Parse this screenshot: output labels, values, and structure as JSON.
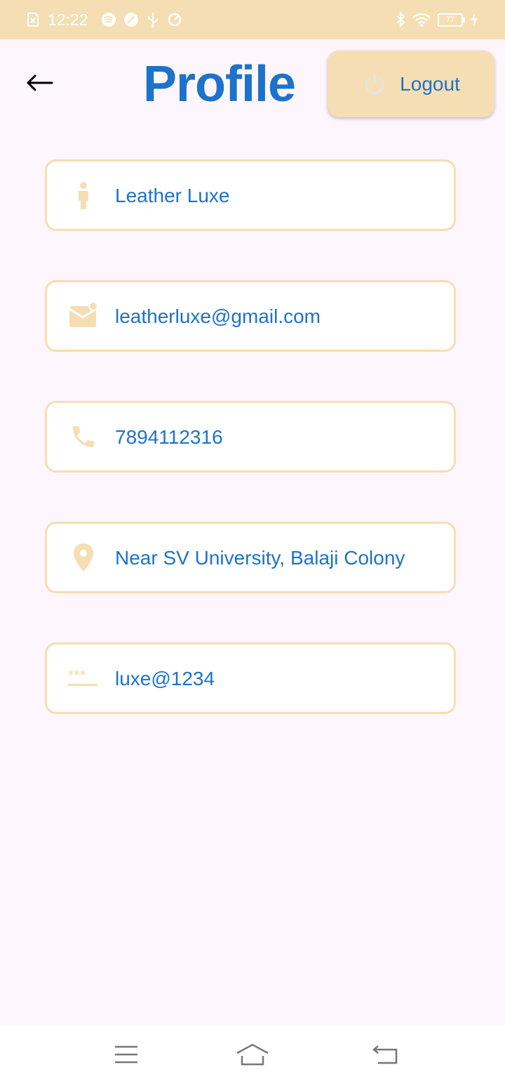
{
  "status_bar": {
    "time": "12:22",
    "battery": "77"
  },
  "header": {
    "title": "Profile",
    "logout_label": "Logout"
  },
  "fields": [
    {
      "icon": "person-icon",
      "value": "Leather Luxe"
    },
    {
      "icon": "mail-icon",
      "value": "leatherluxe@gmail.com"
    },
    {
      "icon": "phone-icon",
      "value": "7894112316"
    },
    {
      "icon": "location-pin-icon",
      "value": "Near SV University, Balaji Colony"
    },
    {
      "icon": "password-icon",
      "value": "luxe@1234"
    }
  ],
  "colors": {
    "accent": "#1d72c9",
    "beige": "#f5deb3",
    "background": "#fdf6fd"
  }
}
